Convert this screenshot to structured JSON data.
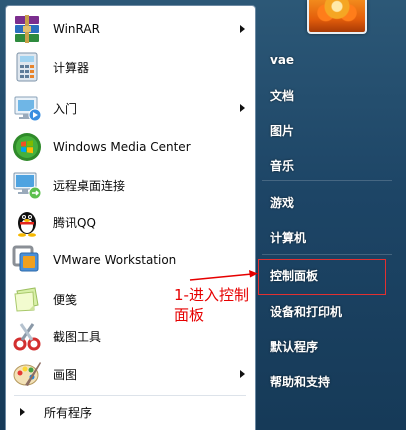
{
  "programs": [
    {
      "label": "WinRAR",
      "icon": "winrar-icon",
      "has_submenu": true
    },
    {
      "label": "计算器",
      "icon": "calculator-icon",
      "has_submenu": false
    },
    {
      "label": "入门",
      "icon": "getting-started-icon",
      "has_submenu": true
    },
    {
      "label": "Windows Media Center",
      "icon": "windows-media-center-icon",
      "has_submenu": false
    },
    {
      "label": "远程桌面连接",
      "icon": "remote-desktop-icon",
      "has_submenu": false
    },
    {
      "label": "腾讯QQ",
      "icon": "qq-penguin-icon",
      "has_submenu": false
    },
    {
      "label": "VMware Workstation",
      "icon": "vmware-icon",
      "has_submenu": false
    },
    {
      "label": "便笺",
      "icon": "sticky-notes-icon",
      "has_submenu": false
    },
    {
      "label": "截图工具",
      "icon": "snipping-tool-icon",
      "has_submenu": false
    },
    {
      "label": "画图",
      "icon": "paint-icon",
      "has_submenu": true
    }
  ],
  "all_programs_label": "所有程序",
  "right_items": [
    {
      "label": "vae"
    },
    {
      "label": "文档"
    },
    {
      "label": "图片"
    },
    {
      "label": "音乐"
    },
    {
      "label": "游戏"
    },
    {
      "label": "计算机"
    },
    {
      "label": "控制面板"
    },
    {
      "label": "设备和打印机"
    },
    {
      "label": "默认程序"
    },
    {
      "label": "帮助和支持"
    }
  ],
  "annotation": {
    "text": "1-进入控制面板",
    "color": "#e60000"
  },
  "colors": {
    "right_panel_bg": "#1d4566",
    "highlight_border": "#e23030"
  }
}
